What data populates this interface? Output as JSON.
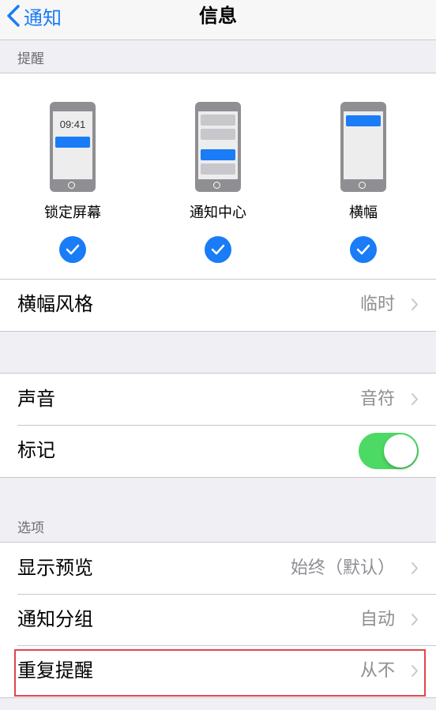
{
  "navbar": {
    "back_label": "通知",
    "title": "信息"
  },
  "alerts": {
    "header": "提醒",
    "options": [
      {
        "label": "锁定屏幕",
        "checked": true,
        "preview_time": "09:41"
      },
      {
        "label": "通知中心",
        "checked": true
      },
      {
        "label": "横幅",
        "checked": true
      }
    ],
    "banner_style": {
      "label": "横幅风格",
      "value": "临时"
    }
  },
  "sound": {
    "label": "声音",
    "value": "音符"
  },
  "badge": {
    "label": "标记",
    "on": true
  },
  "options_section": {
    "header": "选项",
    "rows": [
      {
        "label": "显示预览",
        "value": "始终（默认）"
      },
      {
        "label": "通知分组",
        "value": "自动"
      },
      {
        "label": "重复提醒",
        "value": "从不"
      }
    ]
  },
  "colors": {
    "accent": "#1a7cf6",
    "toggle_on": "#4cd964",
    "highlight": "#e0474c"
  }
}
